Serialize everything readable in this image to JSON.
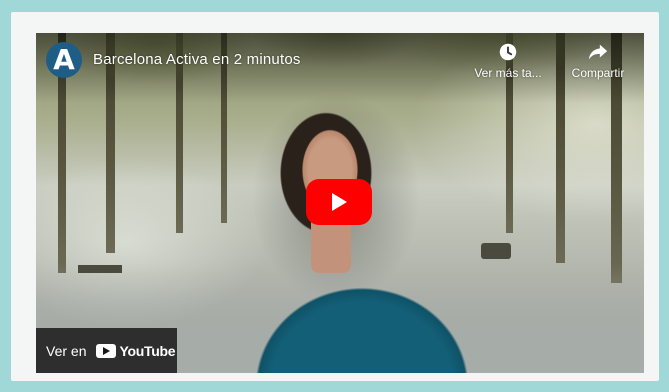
{
  "video": {
    "title": "Barcelona Activa en 2 minutos",
    "channel_logo_letter": "A"
  },
  "actions": {
    "watch_later_label": "Ver más ta...",
    "share_label": "Compartir"
  },
  "watch_on": {
    "label": "Ver en",
    "brand": "YouTube"
  },
  "icons": {
    "watch_later": "clock-icon",
    "share": "share-arrow-icon",
    "play": "play-icon",
    "youtube": "youtube-logo-icon"
  },
  "colors": {
    "page_background": "#9fd8d6",
    "card_background": "#f4f6f5",
    "play_button": "#ff0000",
    "channel_logo": "#1e5d86"
  }
}
